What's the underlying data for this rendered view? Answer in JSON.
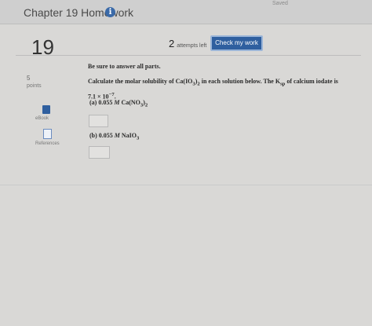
{
  "header": {
    "title": "Chapter 19 Homework",
    "info_icon": "info-icon",
    "info_glyph": "i",
    "saved_text": "Saved"
  },
  "question": {
    "number": "19",
    "attempts_count": "2",
    "attempts_label": "attempts left",
    "check_label": "Check my work",
    "points_value": "5",
    "points_label": "points",
    "instruction": "Be sure to answer all parts.",
    "text_before": "Calculate the molar solubility of Ca(IO",
    "text_sub1": "3",
    "text_mid1": ")",
    "text_sub2": "2",
    "text_mid2": " in each solution below. The K",
    "text_sub3": "sp",
    "text_after": " of calcium iodate is",
    "ksp_value": "7.1 × 10",
    "ksp_exp": "−7",
    "ksp_end": ".",
    "part_a_label": "(a) 0.055 ",
    "part_a_M": "M",
    "part_a_formula": " Ca(NO",
    "part_a_sub": "3",
    "part_a_end": ")",
    "part_a_sub2": "2",
    "part_b_label": "(b) 0.055 ",
    "part_b_M": "M",
    "part_b_formula": " NaIO",
    "part_b_sub": "3"
  },
  "sidebar": {
    "ebook_label": "eBook",
    "references_label": "References"
  },
  "colors": {
    "accent": "#2f5f9f",
    "background": "#d9d8d6"
  }
}
